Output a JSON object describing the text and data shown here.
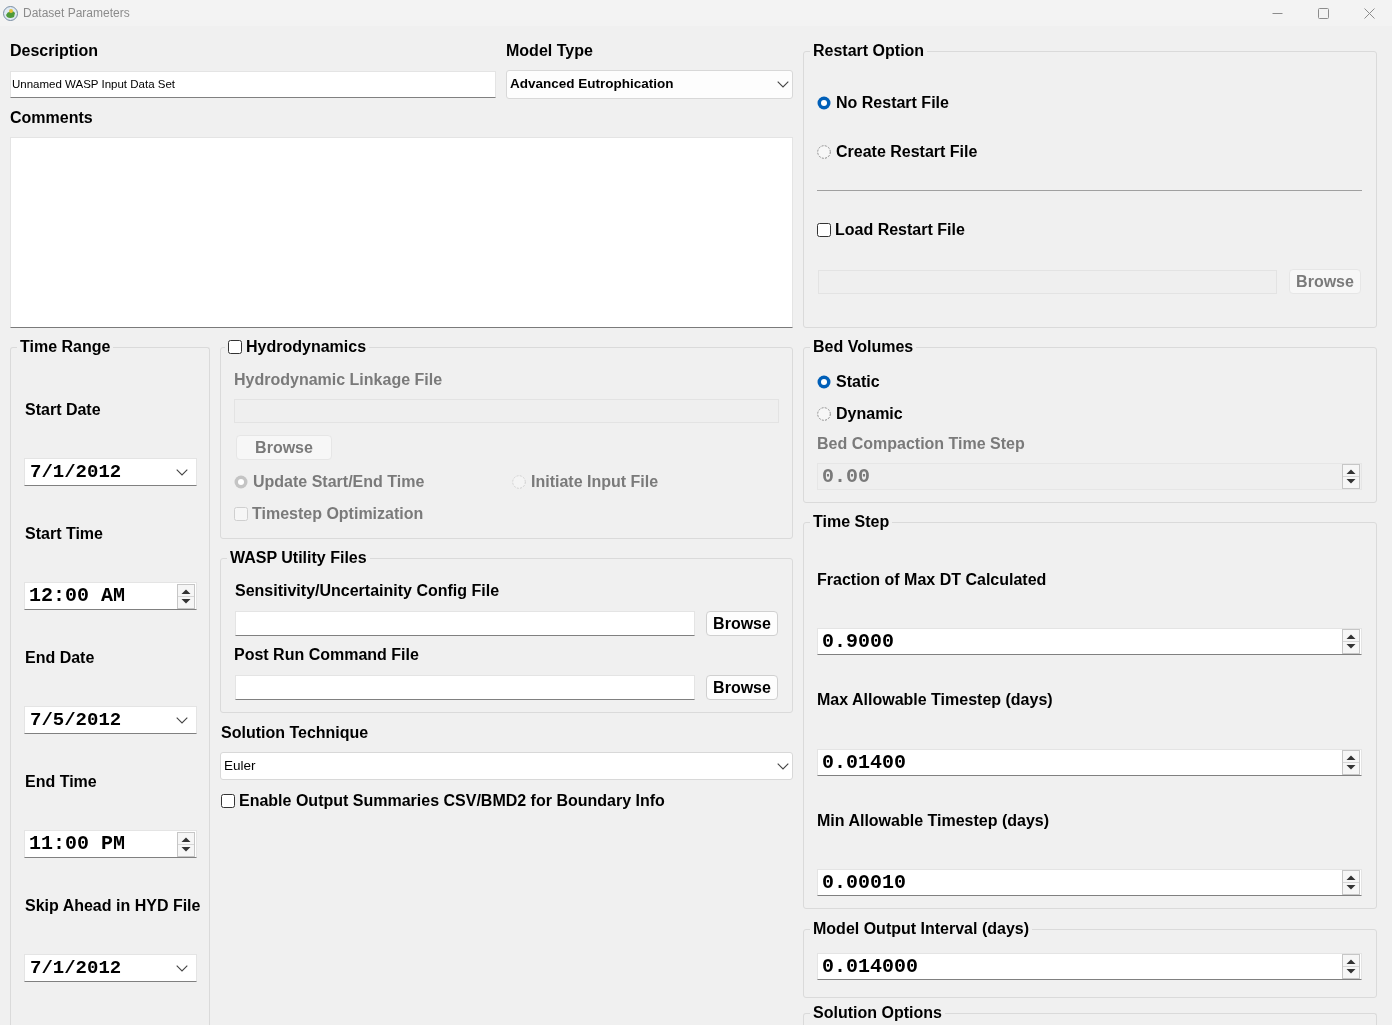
{
  "window": {
    "title": "Dataset Parameters"
  },
  "description": {
    "label": "Description",
    "value": "Unnamed WASP Input Data Set"
  },
  "model_type": {
    "label": "Model Type",
    "value": "Advanced Eutrophication"
  },
  "restart_option": {
    "title": "Restart Option",
    "options": [
      {
        "label": "No Restart File",
        "selected": true
      },
      {
        "label": "Create Restart File",
        "selected": false
      }
    ],
    "load_restart_file": {
      "label": "Load Restart File",
      "checked": false
    },
    "browse_button": "Browse"
  },
  "comments": {
    "label": "Comments"
  },
  "time_range": {
    "title": "Time Range",
    "fields": [
      {
        "label": "Start Date",
        "kind": "date",
        "value": "7/1/2012"
      },
      {
        "label": "Start Time",
        "kind": "time",
        "value": "12:00 AM"
      },
      {
        "label": "End Date",
        "kind": "date",
        "value": "7/5/2012"
      },
      {
        "label": "End Time",
        "kind": "time",
        "value": "11:00 PM"
      },
      {
        "label": "Skip Ahead in HYD File",
        "kind": "date",
        "value": "7/1/2012"
      }
    ]
  },
  "hydrodynamics": {
    "title": "Hydrodynamics",
    "checked": false,
    "linkage_file_label": "Hydrodynamic Linkage File",
    "browse_button": "Browse",
    "options": [
      {
        "label": "Update Start/End Time",
        "selected": true
      },
      {
        "label": "Initiate Input File",
        "selected": false
      }
    ],
    "timestep_optimization": {
      "label": "Timestep Optimization",
      "checked": false
    }
  },
  "bed_volumes": {
    "title": "Bed Volumes",
    "options": [
      {
        "label": "Static",
        "selected": true
      },
      {
        "label": "Dynamic",
        "selected": false
      }
    ],
    "compaction_time_step": {
      "label": "Bed Compaction Time Step",
      "value": "0.00",
      "disabled": true
    }
  },
  "wasp_utility_files": {
    "title": "WASP Utility Files",
    "files": [
      {
        "label": "Sensitivity/Uncertainity Config File",
        "button": "Browse"
      },
      {
        "label": "Post Run Command File",
        "button": "Browse"
      }
    ]
  },
  "time_step": {
    "title": "Time Step",
    "fields": [
      {
        "label": "Fraction of Max DT Calculated",
        "value": "0.9000"
      },
      {
        "label": "Max Allowable Timestep (days)",
        "value": "0.01400"
      },
      {
        "label": "Min Allowable Timestep (days)",
        "value": "0.00010"
      }
    ]
  },
  "solution_technique": {
    "label": "Solution Technique",
    "value": "Euler"
  },
  "output_summaries": {
    "label": "Enable Output Summaries CSV/BMD2 for Boundary Info",
    "checked": false
  },
  "model_output_interval": {
    "title": "Model Output Interval (days)",
    "value": "0.014000"
  },
  "solution_options": {
    "title": "Solution Options"
  }
}
